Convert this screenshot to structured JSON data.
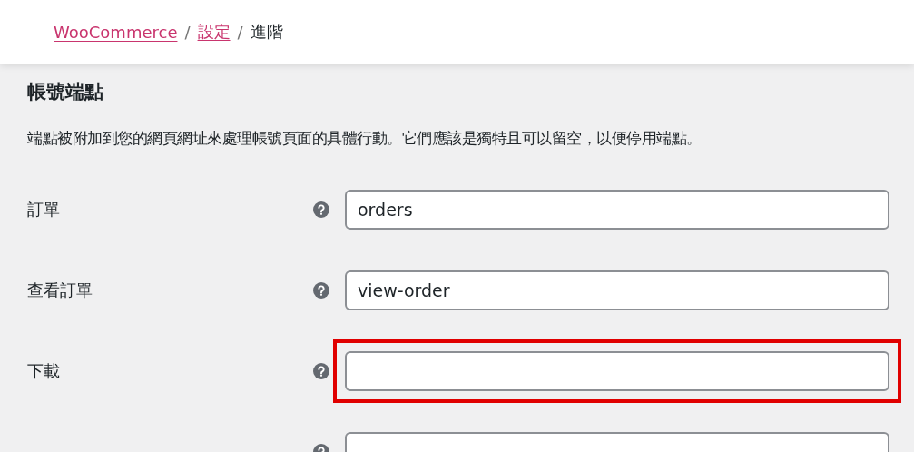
{
  "breadcrumb": [
    {
      "label": "WooCommerce",
      "link": true
    },
    {
      "label": "設定",
      "link": true
    },
    {
      "label": "進階",
      "link": false
    }
  ],
  "breadcrumb_separator": "/",
  "section": {
    "title": "帳號端點",
    "description": "端點被附加到您的網頁網址來處理帳號頁面的具體行動。它們應該是獨特且可以留空，以便停用端點。"
  },
  "fields": [
    {
      "label": "訂單",
      "value": "orders",
      "highlighted": false
    },
    {
      "label": "查看訂單",
      "value": "view-order",
      "highlighted": false
    },
    {
      "label": "下載",
      "highlighted": true
    },
    {
      "highlighted": false
    }
  ]
}
